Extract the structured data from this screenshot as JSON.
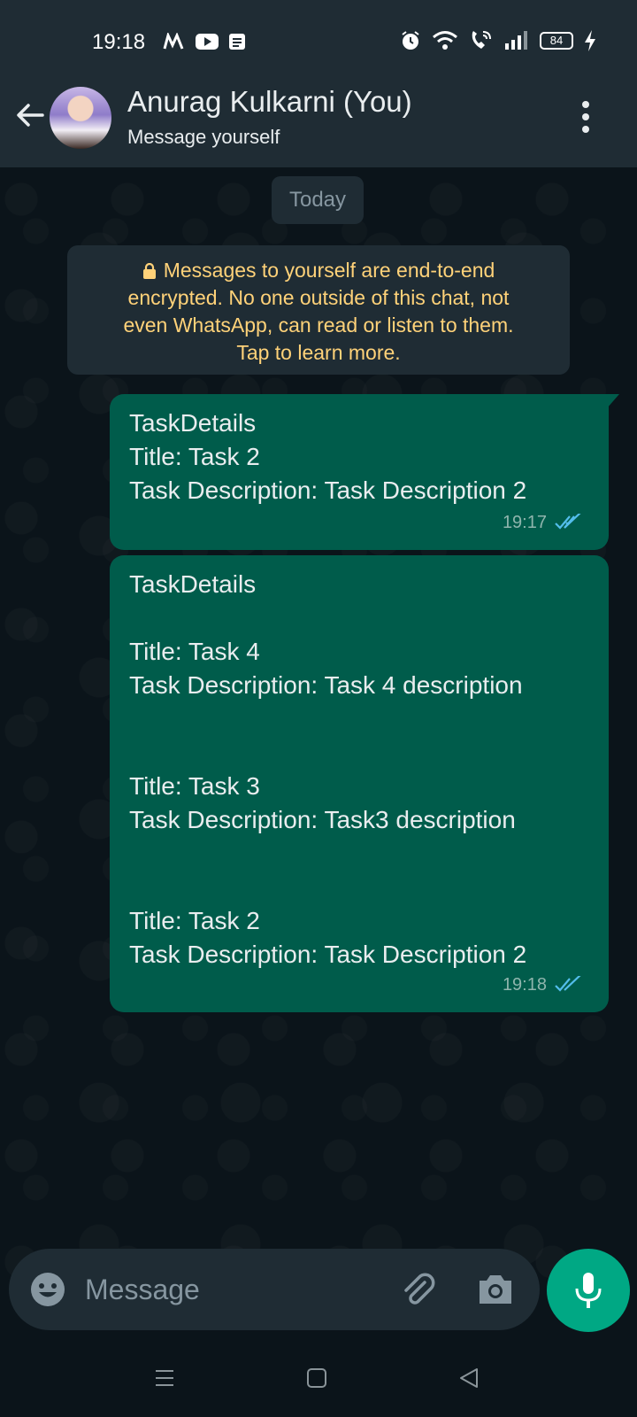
{
  "status_bar": {
    "time": "19:18",
    "battery": "84",
    "left_icons": [
      "myntra-icon",
      "youtube-icon",
      "notes-icon"
    ],
    "right_icons": [
      "alarm-icon",
      "wifi-icon",
      "wifi-call-icon",
      "signal-icon",
      "battery-icon",
      "charging-icon"
    ]
  },
  "header": {
    "contact_name": "Anurag Kulkarni (You)",
    "subtitle": "Message yourself"
  },
  "chat": {
    "date_chip": "Today",
    "encryption_notice": {
      "lines": [
        "Messages to yourself are end-to-end",
        "encrypted. No one outside of this chat, not",
        "even WhatsApp, can read or listen to them.",
        "Tap to learn more."
      ]
    },
    "messages": [
      {
        "lines": [
          "TaskDetails",
          "Title: Task 2",
          "Task Description: Task Description 2"
        ],
        "time": "19:17",
        "status": "read"
      },
      {
        "lines": [
          "TaskDetails",
          "",
          "Title: Task 4",
          "Task Description: Task 4 description",
          "",
          "",
          "Title: Task 3",
          "Task Description: Task3 description",
          "",
          "",
          "Title: Task 2",
          "Task Description: Task Description 2"
        ],
        "time": "19:18",
        "status": "read"
      }
    ]
  },
  "composer": {
    "placeholder": "Message"
  },
  "colors": {
    "header_bg": "#1f2c34",
    "chat_bg": "#0b141a",
    "bubble_out": "#005c4b",
    "accent": "#00a884",
    "notice_text": "#ffd279",
    "read_ticks": "#53bdeb"
  }
}
